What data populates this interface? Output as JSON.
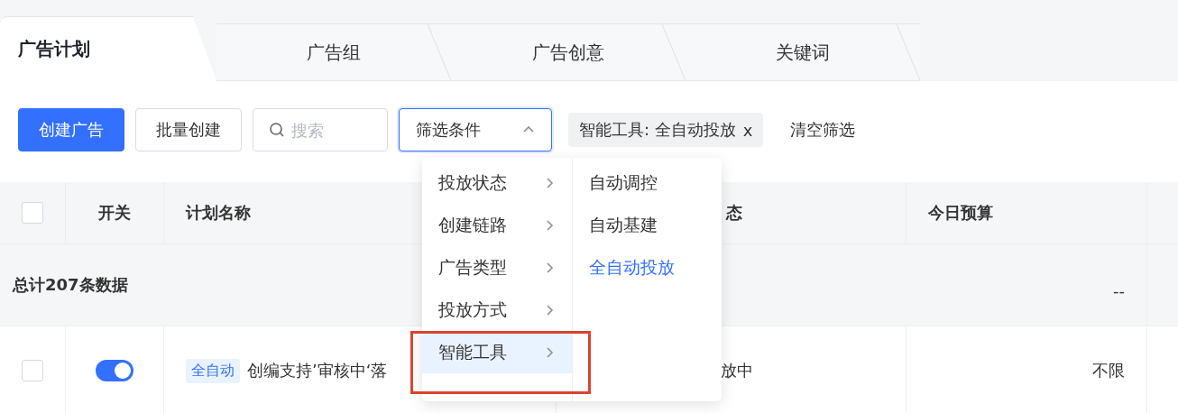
{
  "tabs": [
    {
      "label": "广告计划",
      "selected": true
    },
    {
      "label": "广告组",
      "selected": false
    },
    {
      "label": "广告创意",
      "selected": false
    },
    {
      "label": "关键词",
      "selected": false
    }
  ],
  "toolbar": {
    "primary_button": "创建广告",
    "secondary_button": "批量创建",
    "search": {
      "placeholder": "搜索"
    },
    "filter_dropdown": {
      "label": "筛选条件",
      "expanded": true
    },
    "filter_tag": {
      "label": "智能工具: 全自动投放",
      "close": "x"
    },
    "clear_link": "清空筛选"
  },
  "filter_menu": {
    "items": [
      {
        "label": "投放状态",
        "selected": false
      },
      {
        "label": "创建链路",
        "selected": false
      },
      {
        "label": "广告类型",
        "selected": false
      },
      {
        "label": "投放方式",
        "selected": false
      },
      {
        "label": "智能工具",
        "selected": true
      }
    ],
    "submenu": [
      {
        "label": "自动调控",
        "selected": false
      },
      {
        "label": "自动基建",
        "selected": false
      },
      {
        "label": "全自动投放",
        "selected": true
      }
    ]
  },
  "table": {
    "select_all_checked": false,
    "columns": [
      "开关",
      "计划名称",
      "态",
      "今日预算"
    ],
    "summary": {
      "label": "总计207条数据",
      "budget": "--"
    },
    "rows": [
      {
        "checked": false,
        "on": true,
        "tag": "全自动",
        "name": "创编支持’审核中‘落",
        "status": "放中",
        "budget": "不限"
      }
    ]
  }
}
